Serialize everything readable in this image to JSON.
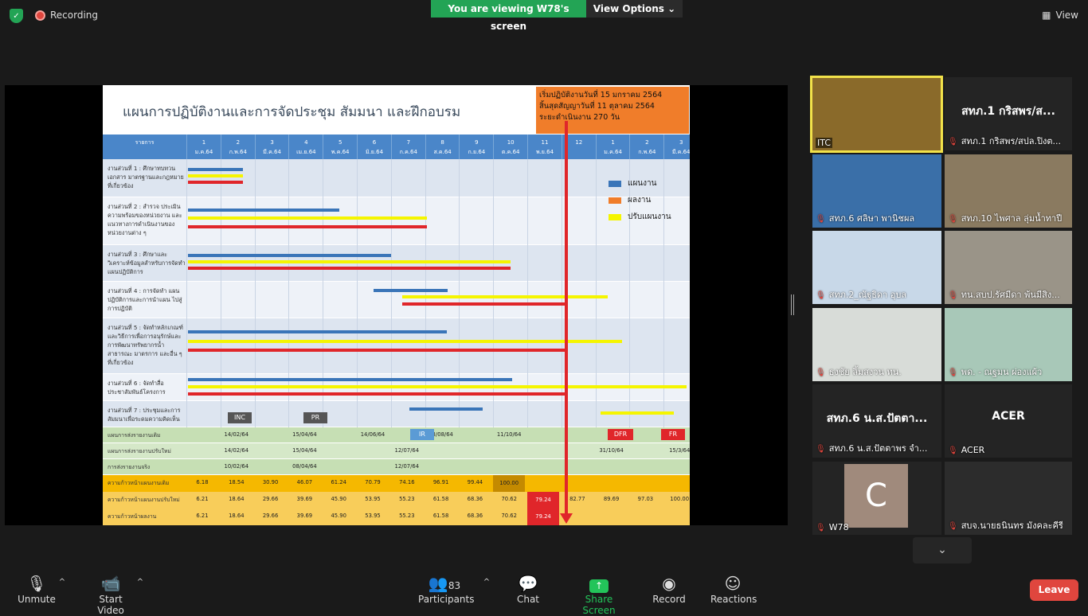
{
  "topbar": {
    "recording_label": "Recording",
    "viewing_banner": "You are viewing W78's screen",
    "view_options": "View Options",
    "view_label": "View"
  },
  "slide": {
    "title": "แผนการปฏิบัติงานและการจัดประชุม สัมมนา และฝึกอบรม",
    "info_lines": [
      "เริ่มปฏิบัติงานวันที่ 15 มกราคม 2564",
      "สิ้นสุดสัญญาวันที่ 11 ตุลาคม 2564",
      "ระยะดำเนินงาน 270 วัน"
    ],
    "header_first": "รายการ",
    "months": [
      {
        "n": "1",
        "m": "ม.ค.64"
      },
      {
        "n": "2",
        "m": "ก.พ.64"
      },
      {
        "n": "3",
        "m": "มี.ค.64"
      },
      {
        "n": "4",
        "m": "เม.ย.64"
      },
      {
        "n": "5",
        "m": "พ.ค.64"
      },
      {
        "n": "6",
        "m": "มิ.ย.64"
      },
      {
        "n": "7",
        "m": "ก.ค.64"
      },
      {
        "n": "8",
        "m": "ส.ค.64"
      },
      {
        "n": "9",
        "m": "ก.ย.64"
      },
      {
        "n": "10",
        "m": "ต.ค.64"
      },
      {
        "n": "11",
        "m": "พ.ย.64"
      },
      {
        "n": "12",
        "m": ""
      },
      {
        "n": "1",
        "m": "ม.ค.64"
      },
      {
        "n": "2",
        "m": "ก.พ.64"
      },
      {
        "n": "3",
        "m": "มี.ค.64"
      }
    ],
    "tasks": [
      "งานส่วนที่ 1 : ศึกษาทบทวน เอกสาร มาตรฐานและกฎหมาย ที่เกี่ยวข้อง",
      "งานส่วนที่ 2 : สำรวจ ประเมิน ความพร้อมของหน่วยงาน และ แนวทางการดำเนินงานของ หน่วยงานต่าง ๆ",
      "งานส่วนที่ 3 : ศึกษาและ วิเคราะห์ข้อมูลสำหรับการจัดทำ แผนปฏิบัติการ",
      "งานส่วนที่ 4 : การจัดทำ แผนปฏิบัติการและการนำแผน ไปสู่การปฏิบัติ",
      "งานส่วนที่ 5 : จัดทำหลักเกณฑ์ และวิธีการเพื่อการอนุรักษ์และ การพัฒนาทรัพยากรน้ำ สาธารณะ มาตรการ และอื่น ๆ ที่เกี่ยวข้อง",
      "งานส่วนที่ 6 : จัดทำสื่อ ประชาสัมพันธ์โครงการ",
      "งานส่วนที่ 7 : ประชุมและการ สัมมนาเพื่อระดมความคิดเห็น"
    ],
    "legend": [
      {
        "label": "แผนงาน",
        "color": "#3a75b8"
      },
      {
        "label": "ผลงาน",
        "color": "#f07d2a"
      },
      {
        "label": "ปรับแผนงาน",
        "color": "#f5f500"
      }
    ],
    "tags": [
      "INC",
      "PR",
      "IR",
      "DFR",
      "FR"
    ],
    "report_rows": [
      {
        "label": "แผนการส่งรายงานเดิม",
        "vals": [
          "",
          "14/02/64",
          "",
          "15/04/64",
          "",
          "14/06/64",
          "",
          "13/08/64",
          "",
          "11/10/64",
          "",
          "",
          "",
          "",
          ""
        ]
      },
      {
        "label": "แผนการส่งรายงานปรับใหม่",
        "vals": [
          "",
          "14/02/64",
          "",
          "15/04/64",
          "",
          "",
          "12/07/64",
          "",
          "",
          "",
          "",
          "",
          "31/10/64",
          "",
          "15/3/64"
        ]
      },
      {
        "label": "การส่งรายงานจริง",
        "vals": [
          "",
          "10/02/64",
          "",
          "08/04/64",
          "",
          "",
          "12/07/64",
          "",
          "",
          "",
          "",
          "",
          "",
          "",
          ""
        ]
      }
    ],
    "progress_rows": [
      {
        "label": "ความก้าวหน้าแผนงานเดิม",
        "vals": [
          "6.18",
          "18.54",
          "30.90",
          "46.07",
          "61.24",
          "70.79",
          "74.16",
          "96.91",
          "99.44",
          "100.00",
          "",
          "",
          "",
          "",
          ""
        ]
      },
      {
        "label": "ความก้าวหน้าแผนงานปรับใหม่",
        "vals": [
          "6.21",
          "18.64",
          "29.66",
          "39.69",
          "45.90",
          "53.95",
          "55.23",
          "61.58",
          "68.36",
          "70.62",
          "79.24",
          "82.77",
          "89.69",
          "97.03",
          "100.00"
        ]
      },
      {
        "label": "ความก้าวหน้าผลงาน",
        "vals": [
          "6.21",
          "18.64",
          "29.66",
          "39.69",
          "45.90",
          "53.95",
          "55.23",
          "61.58",
          "68.36",
          "70.62",
          "79.24",
          "",
          "",
          "",
          ""
        ]
      }
    ]
  },
  "participants_panel": [
    {
      "big": "",
      "name": "ITC",
      "muted": false
    },
    {
      "big": "สทภ.1 กริสพร/ส...",
      "name": "สทภ.1 กริสพร/สปล.ปิงต...",
      "muted": true
    },
    {
      "big": "",
      "name": "สทภ.6 ศลิษา พานิชผล",
      "muted": true
    },
    {
      "big": "",
      "name": "สทภ.10 ไพศาล ลุ่มน้ำทาปี",
      "muted": true
    },
    {
      "big": "",
      "name": "สทภ.2_ณัฐธิดา อุบล",
      "muted": true
    },
    {
      "big": "",
      "name": "ทน.สบป.รัศมีดา พ้นมีสิง...",
      "muted": true
    },
    {
      "big": "",
      "name": "ธงชัย ลิ้มสงวน ทน.",
      "muted": true
    },
    {
      "big": "",
      "name": "พด. - ณฐมน ผ่องแผ้ว",
      "muted": true
    },
    {
      "big": "สทภ.6 น.ส.ปัตตา...",
      "name": "สทภ.6 น.ส.ปัตตาพร จำ...",
      "muted": true
    },
    {
      "big": "ACER",
      "name": "ACER",
      "muted": true
    },
    {
      "big": "C",
      "name": "W78",
      "muted": true
    },
    {
      "big": "",
      "name": "สบจ.นายธนินทร มังคละคีรี",
      "muted": true
    }
  ],
  "controls": {
    "unmute": "Unmute",
    "start_video": "Start Video",
    "participants": "Participants",
    "participant_count": "83",
    "chat": "Chat",
    "share_screen": "Share Screen",
    "record": "Record",
    "reactions": "Reactions",
    "leave": "Leave"
  }
}
